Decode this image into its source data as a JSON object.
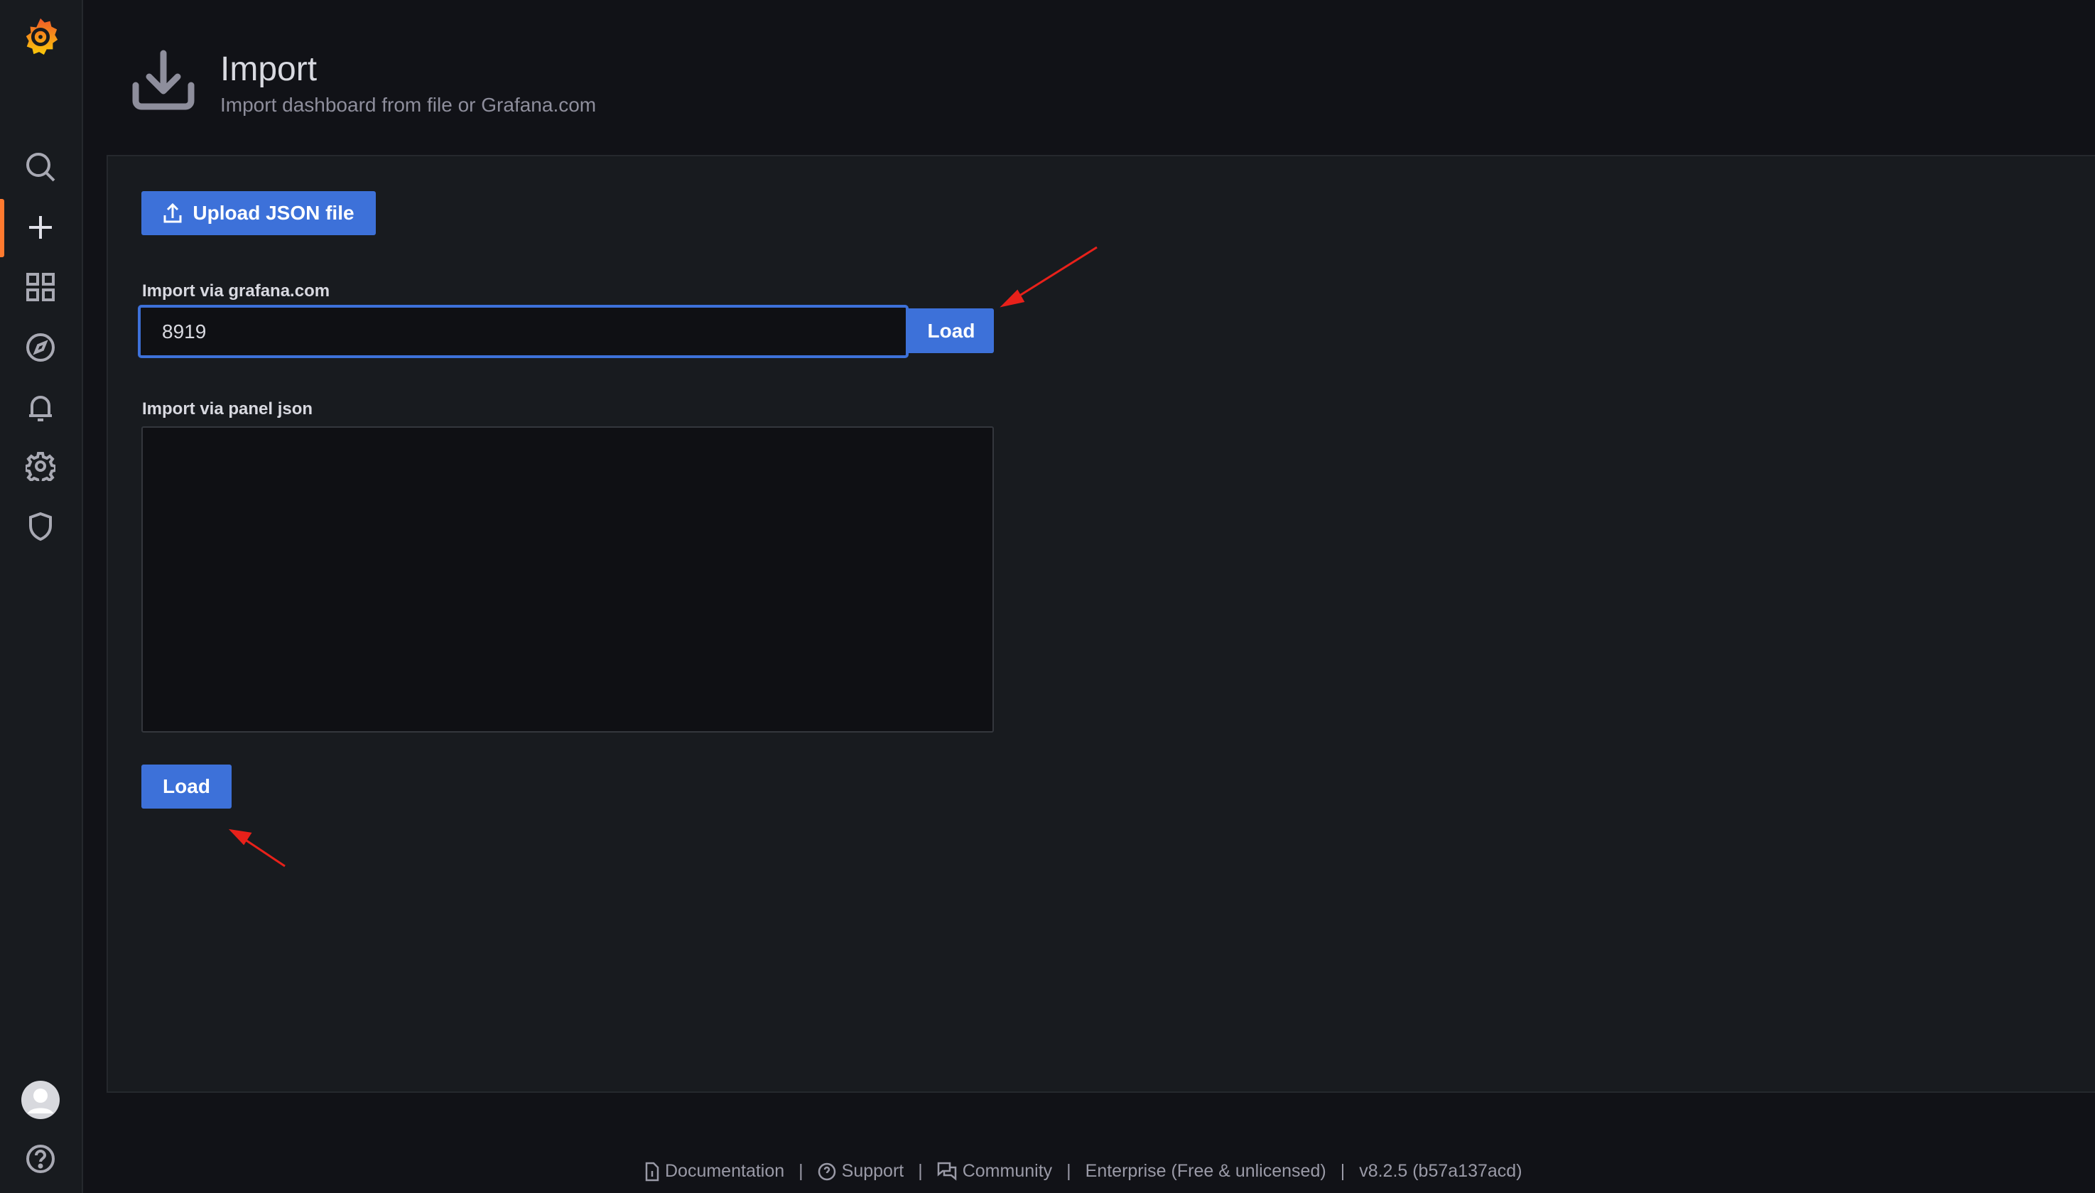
{
  "sidebar": {
    "items": [
      {
        "name": "search",
        "icon": "search-icon"
      },
      {
        "name": "create",
        "icon": "plus-icon",
        "active": true
      },
      {
        "name": "dashboards",
        "icon": "grid-icon"
      },
      {
        "name": "explore",
        "icon": "compass-icon"
      },
      {
        "name": "alerting",
        "icon": "bell-icon"
      },
      {
        "name": "configuration",
        "icon": "gear-icon"
      },
      {
        "name": "server-admin",
        "icon": "shield-icon"
      }
    ],
    "accent": "#ff7a2f"
  },
  "header": {
    "title": "Import",
    "subtitle": "Import dashboard from file or Grafana.com"
  },
  "main": {
    "upload_label": "Upload JSON file",
    "grafana_label": "Import via grafana.com",
    "grafana_value": "8919",
    "load_label": "Load",
    "panel_json_label": "Import via panel json",
    "panel_json_value": "",
    "load2_label": "Load"
  },
  "footer": {
    "items": [
      "Documentation",
      "Support",
      "Community",
      "Enterprise (Free & unlicensed)",
      "v8.2.5 (b57a137acd)"
    ]
  },
  "colors": {
    "primary": "#3d71d9",
    "background": "#111217",
    "annotation_arrow": "#e8211a"
  }
}
